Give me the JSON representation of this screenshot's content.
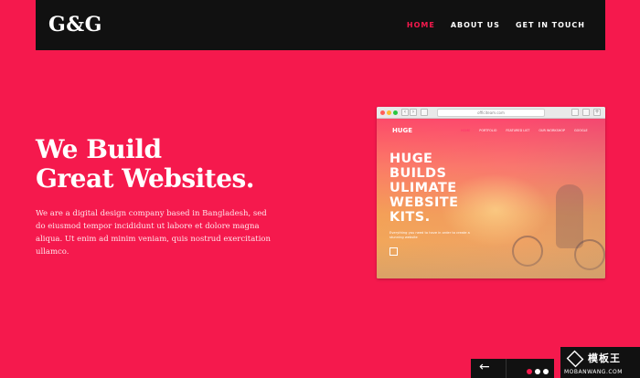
{
  "header": {
    "logo": "G&G",
    "nav": [
      {
        "label": "HOME",
        "active": true
      },
      {
        "label": "ABOUT US",
        "active": false
      },
      {
        "label": "GET IN TOUCH",
        "active": false
      }
    ]
  },
  "hero": {
    "title_line1": "We Build",
    "title_line2": "Great Websites.",
    "description": "We are a digital design company based in Bangladesh, sed do eiusmod tempor incididunt ut labore et dolore magna aliqua. Ut enim ad minim veniam, quis nostrud exercitation ullamco."
  },
  "mockup": {
    "url": "officiteam.com",
    "site_logo": "HUGE",
    "site_nav": [
      "HOME",
      "PORTFOLIO",
      "FEATURED LIST",
      "OUR WORKSHOP",
      "GOOGLE"
    ],
    "headline": [
      "HUGE",
      "BUILDS",
      "ULIMATE",
      "WEBSITE",
      "KITS."
    ],
    "subtext": "Everything you need to have in order to create a stunning website"
  },
  "slider": {
    "prev_icon": "arrow-left-icon",
    "dots": [
      true,
      false,
      false
    ]
  },
  "watermark": {
    "cn": "模板王",
    "en": "MOBANWANG.COM"
  },
  "colors": {
    "background": "#f5194d",
    "header": "#111111",
    "accent": "#f5194d"
  }
}
